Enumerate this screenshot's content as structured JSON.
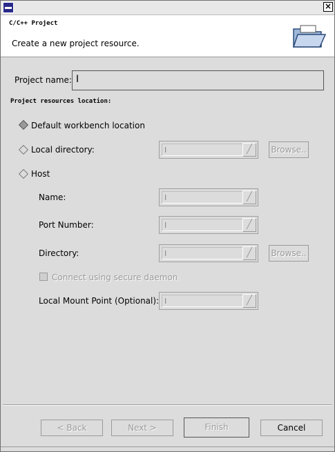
{
  "window": {
    "close_label": "×"
  },
  "header": {
    "title": "C/C++ Project",
    "description": "Create a new project resource."
  },
  "project_name": {
    "label": "Project name:",
    "value": ""
  },
  "section": {
    "title": "Project resources location:"
  },
  "location": {
    "default_label": "Default workbench location",
    "local_label": "Local directory:",
    "host_label": "Host",
    "selected": "Default workbench location"
  },
  "host": {
    "name_label": "Name:",
    "port_label": "Port Number:",
    "directory_label": "Directory:",
    "secure_label": "Connect using secure daemon",
    "mount_label": "Local Mount Point (Optional):"
  },
  "browse_label": "Browse..",
  "buttons": {
    "back": "< Back",
    "next": "Next >",
    "finish": "Finish",
    "cancel": "Cancel"
  }
}
